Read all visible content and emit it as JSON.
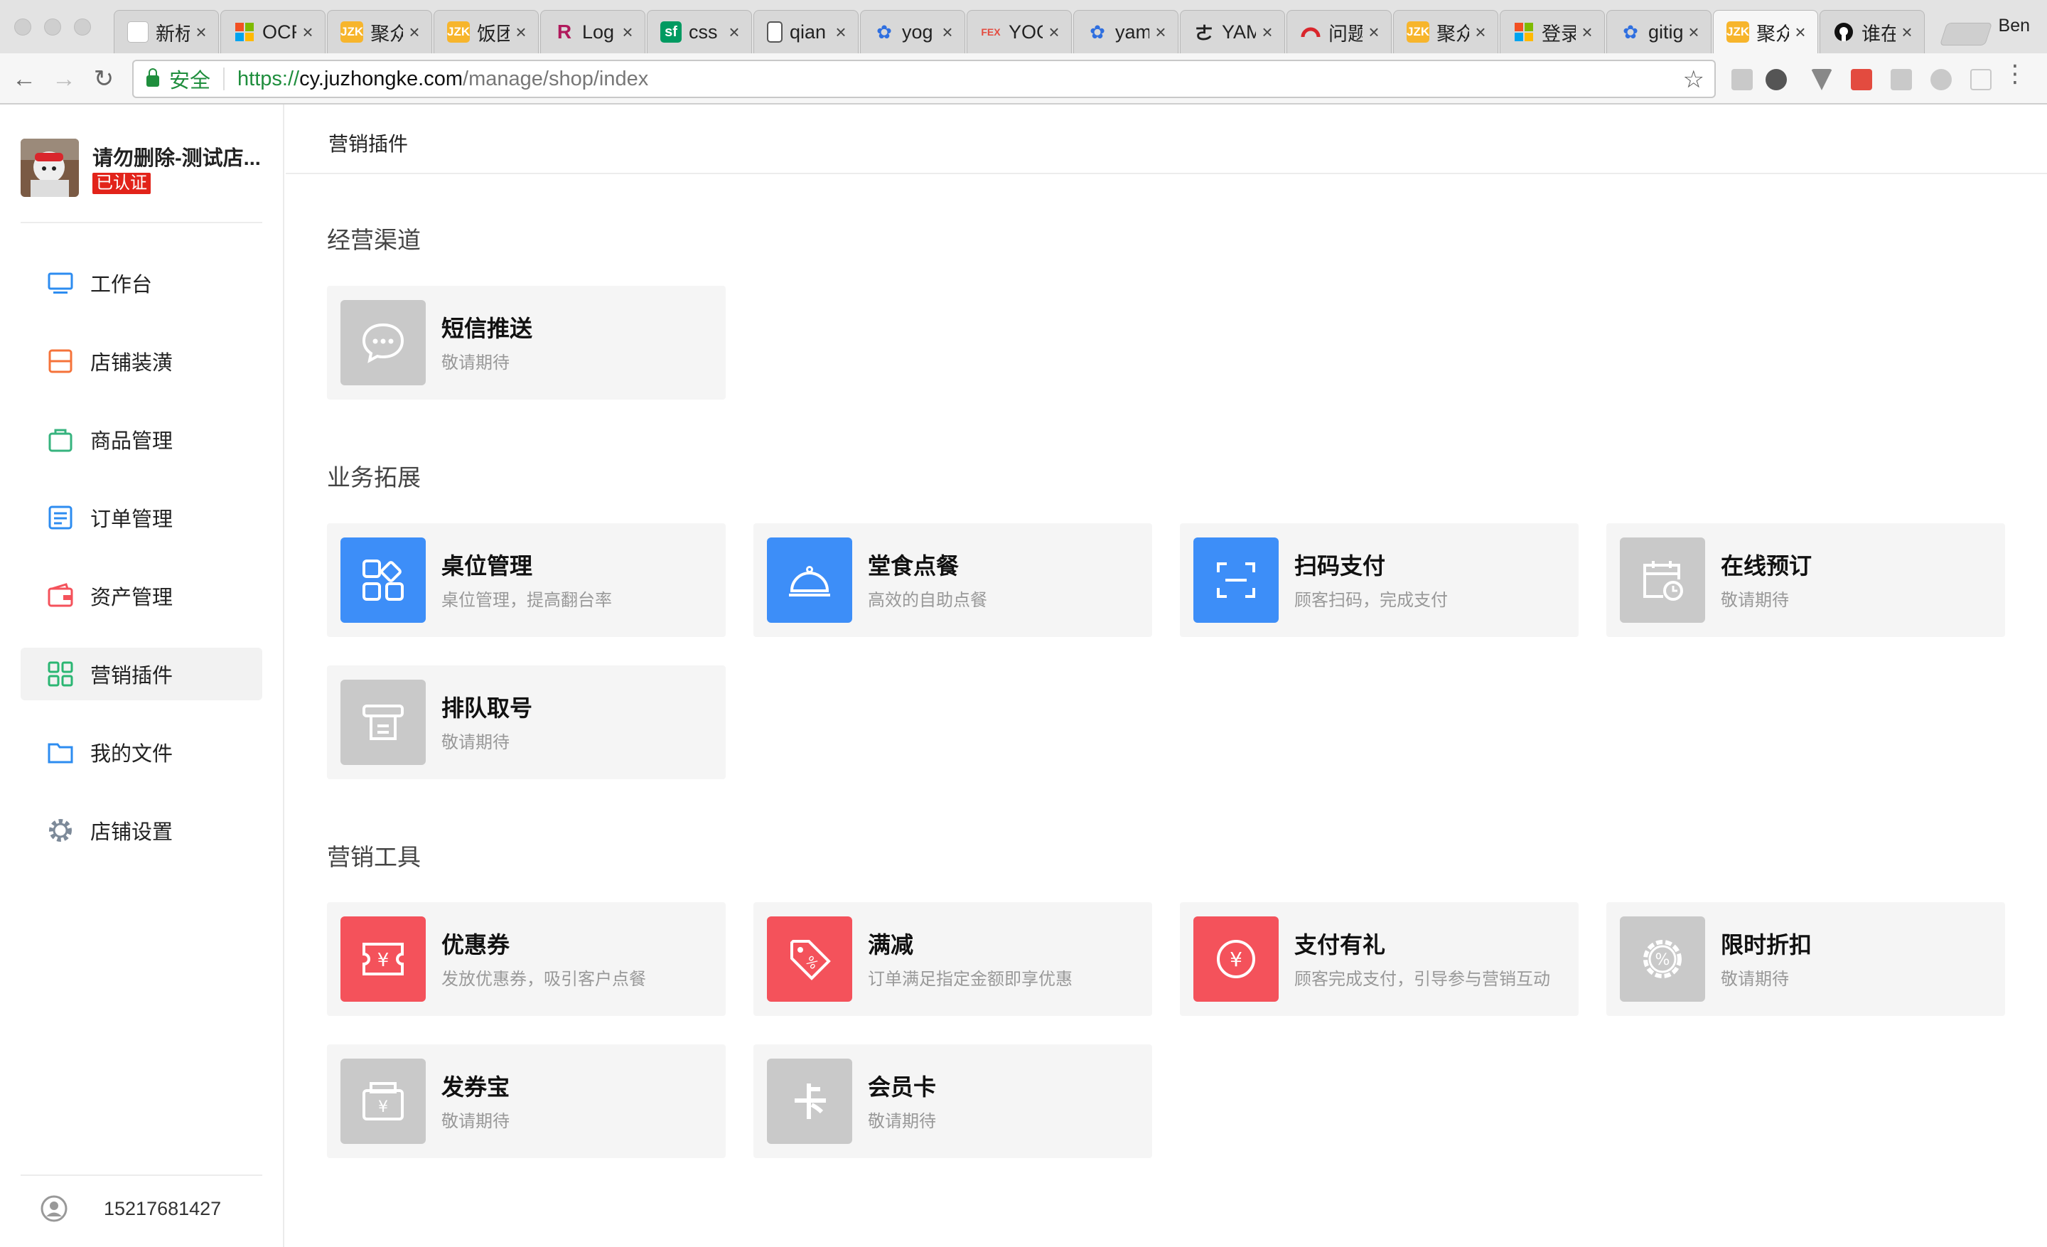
{
  "browser": {
    "tabs": [
      {
        "title": "新标签页",
        "favicon": "page-icon",
        "active": false
      },
      {
        "title": "OCR",
        "favicon": "windows-logo-icon",
        "active": false
      },
      {
        "title": "聚众",
        "favicon": "jzk-icon",
        "active": false
      },
      {
        "title": "饭团",
        "favicon": "jzk-icon",
        "active": false
      },
      {
        "title": "Log",
        "favicon": "r-logo-icon",
        "active": false
      },
      {
        "title": "css",
        "favicon": "sf-logo-icon",
        "active": false
      },
      {
        "title": "qian",
        "favicon": "document-icon",
        "active": false
      },
      {
        "title": "yog",
        "favicon": "baidu-paw-icon",
        "active": false
      },
      {
        "title": "YOG",
        "favicon": "fex-logo-icon",
        "active": false
      },
      {
        "title": "yam",
        "favicon": "baidu-paw-icon",
        "active": false
      },
      {
        "title": "YAM",
        "favicon": "calligraphy-icon",
        "active": false
      },
      {
        "title": "问题",
        "favicon": "gauge-icon",
        "active": false
      },
      {
        "title": "聚众",
        "favicon": "jzk-icon",
        "active": false
      },
      {
        "title": "登录",
        "favicon": "windows-logo-icon",
        "active": false
      },
      {
        "title": "gitig",
        "favicon": "baidu-paw-icon",
        "active": false
      },
      {
        "title": "聚众",
        "favicon": "jzk-icon",
        "active": true
      },
      {
        "title": "谁在",
        "favicon": "github-icon",
        "active": false
      }
    ],
    "profile_name": "Ben",
    "security_label": "安全",
    "url_scheme": "https://",
    "url_host": "cy.juzhongke.com",
    "url_path": "/manage/shop/index"
  },
  "sidebar": {
    "shop_name": "请勿删除-测试店...",
    "verified_badge": "已认证",
    "items": [
      {
        "label": "工作台",
        "icon": "monitor-icon",
        "color": "#2d8cf0",
        "active": false
      },
      {
        "label": "店铺装潢",
        "icon": "store-icon",
        "color": "#f5733a",
        "active": false
      },
      {
        "label": "商品管理",
        "icon": "bag-icon",
        "color": "#36b37e",
        "active": false
      },
      {
        "label": "订单管理",
        "icon": "list-icon",
        "color": "#2d8cf0",
        "active": false
      },
      {
        "label": "资产管理",
        "icon": "wallet-icon",
        "color": "#f4525b",
        "active": false
      },
      {
        "label": "营销插件",
        "icon": "grid-icon",
        "color": "#2bb673",
        "active": true
      },
      {
        "label": "我的文件",
        "icon": "folder-icon",
        "color": "#2d8cf0",
        "active": false
      },
      {
        "label": "店铺设置",
        "icon": "gear-icon",
        "color": "#7d8a99",
        "active": false
      }
    ],
    "user_phone": "15217681427"
  },
  "main": {
    "page_title": "营销插件",
    "sections": [
      {
        "title": "经营渠道",
        "cards": [
          {
            "title": "短信推送",
            "desc": "敬请期待",
            "icon": "chat-bubble-icon",
            "color": "#c9c9c9"
          }
        ]
      },
      {
        "title": "业务拓展",
        "cards": [
          {
            "title": "桌位管理",
            "desc": "桌位管理，提高翻台率",
            "icon": "table-grid-icon",
            "color": "#3d8ef8"
          },
          {
            "title": "堂食点餐",
            "desc": "高效的自助点餐",
            "icon": "cloche-icon",
            "color": "#3d8ef8"
          },
          {
            "title": "扫码支付",
            "desc": "顾客扫码，完成支付",
            "icon": "scan-icon",
            "color": "#3d8ef8"
          },
          {
            "title": "在线预订",
            "desc": "敬请期待",
            "icon": "calendar-clock-icon",
            "color": "#c9c9c9"
          },
          {
            "title": "排队取号",
            "desc": "敬请期待",
            "icon": "ticket-printer-icon",
            "color": "#c9c9c9"
          }
        ]
      },
      {
        "title": "营销工具",
        "cards": [
          {
            "title": "优惠券",
            "desc": "发放优惠券，吸引客户点餐",
            "icon": "coupon-icon",
            "color": "#f4525b"
          },
          {
            "title": "满减",
            "desc": "订单满足指定金额即享优惠",
            "icon": "discount-tag-icon",
            "color": "#f4525b"
          },
          {
            "title": "支付有礼",
            "desc": "顾客完成支付，引导参与营销互动",
            "icon": "yuan-circle-icon",
            "color": "#f4525b"
          },
          {
            "title": "限时折扣",
            "desc": "敬请期待",
            "icon": "percent-badge-icon",
            "color": "#c9c9c9"
          },
          {
            "title": "发券宝",
            "desc": "敬请期待",
            "icon": "coupon-box-icon",
            "color": "#c9c9c9"
          },
          {
            "title": "会员卡",
            "desc": "敬请期待",
            "icon": "card-ka-icon",
            "color": "#c9c9c9"
          }
        ]
      }
    ]
  }
}
